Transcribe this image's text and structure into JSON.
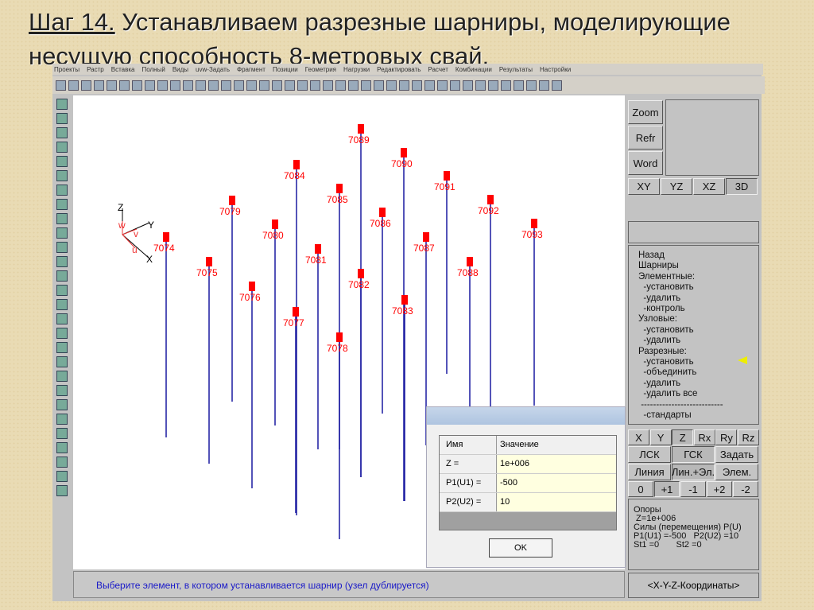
{
  "slide": {
    "step": "Шаг 14.",
    "title_rest": " Устанавливаем разрезные шарниры, моделирующие",
    "title_line2": "несущую способность 8-метровых свай."
  },
  "menu": [
    "Проекты",
    "Растр",
    "Вставка",
    "Полный",
    "Виды",
    "uvw-Задать",
    "Фрагмент",
    "Позиции",
    "Геометрия",
    "Нагрузки",
    "Редактировать",
    "Расчет",
    "Комбинации",
    "Результаты",
    "Настройки"
  ],
  "axes": {
    "z": "Z",
    "y": "Y",
    "x": "X",
    "w": "w",
    "v": "v",
    "u": "u"
  },
  "piles": [
    "7089",
    "7090",
    "7091",
    "7092",
    "7093",
    "7084",
    "7085",
    "7086",
    "7087",
    "7088",
    "7079",
    "7080",
    "7081",
    "7082",
    "7083",
    "7074",
    "7075",
    "7076",
    "7077",
    "7078"
  ],
  "colors": {
    "pile": "#1a1aa0",
    "node": "#ff0000",
    "label": "#ff0000"
  },
  "right": {
    "zoom": "Zoom",
    "refr": "Refr",
    "word": "Word",
    "views": [
      "XY",
      "YZ",
      "XZ",
      "3D"
    ],
    "tree": [
      "Назад",
      "Шарниры",
      "Элементные:",
      "  -установить",
      "  -удалить",
      "  -контроль",
      "Узловые:",
      "  -установить",
      "  -удалить",
      "Разрезные:",
      "  -установить",
      "  -объединить",
      "  -удалить",
      "  -удалить все",
      " ---------------------------",
      "  -стандарты"
    ],
    "dof": [
      "X",
      "Y",
      "Z",
      "Rx",
      "Ry",
      "Rz"
    ],
    "cs": [
      "ЛСК",
      "ГСК",
      "Задать"
    ],
    "mode": [
      "Линия",
      "Лин.+Эл.",
      "Элем."
    ],
    "steps": [
      "0",
      "+1",
      "-1",
      "+2",
      "-2"
    ],
    "info": [
      "Опоры",
      " Z=1e+006",
      "Силы (перемещения) P(U)",
      "P1(U1) =-500   P2(U2) =10",
      "St1 =0       St2 =0"
    ],
    "coords": "<X-Y-Z-Координаты>"
  },
  "dialog": {
    "col_name": "Имя",
    "col_value": "Значение",
    "rows": [
      {
        "k": "Z =",
        "v": "1e+006"
      },
      {
        "k": "P1(U1) =",
        "v": "-500"
      },
      {
        "k": "P2(U2) =",
        "v": "10"
      }
    ],
    "ok": "OK"
  },
  "status": "Выберите элемент, в котором устанавливается шарнир (узел дублируется)"
}
